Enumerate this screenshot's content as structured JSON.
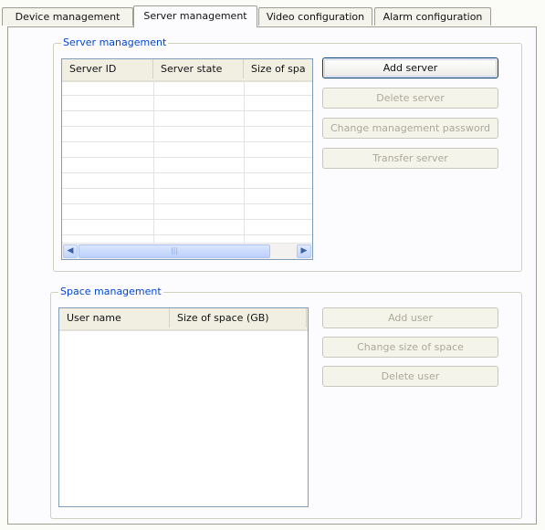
{
  "tabs": [
    {
      "label": "Device management",
      "active": false
    },
    {
      "label": "Server management",
      "active": true
    },
    {
      "label": "Video configuration",
      "active": false
    },
    {
      "label": "Alarm configuration",
      "active": false
    }
  ],
  "server_group": {
    "title": "Server management",
    "columns": [
      "Server ID",
      "Server state",
      "Size of spa"
    ],
    "rows": [],
    "buttons": {
      "add": "Add server",
      "delete": "Delete server",
      "change_password": "Change management password",
      "transfer": "Transfer server"
    }
  },
  "space_group": {
    "title": "Space management",
    "columns": [
      "User name",
      "Size of space (GB)"
    ],
    "rows": [],
    "buttons": {
      "add": "Add user",
      "change_size": "Change size of space",
      "delete": "Delete user"
    }
  },
  "icons": {
    "scroll_left": "◀",
    "scroll_right": "▶",
    "grip": "|||"
  }
}
